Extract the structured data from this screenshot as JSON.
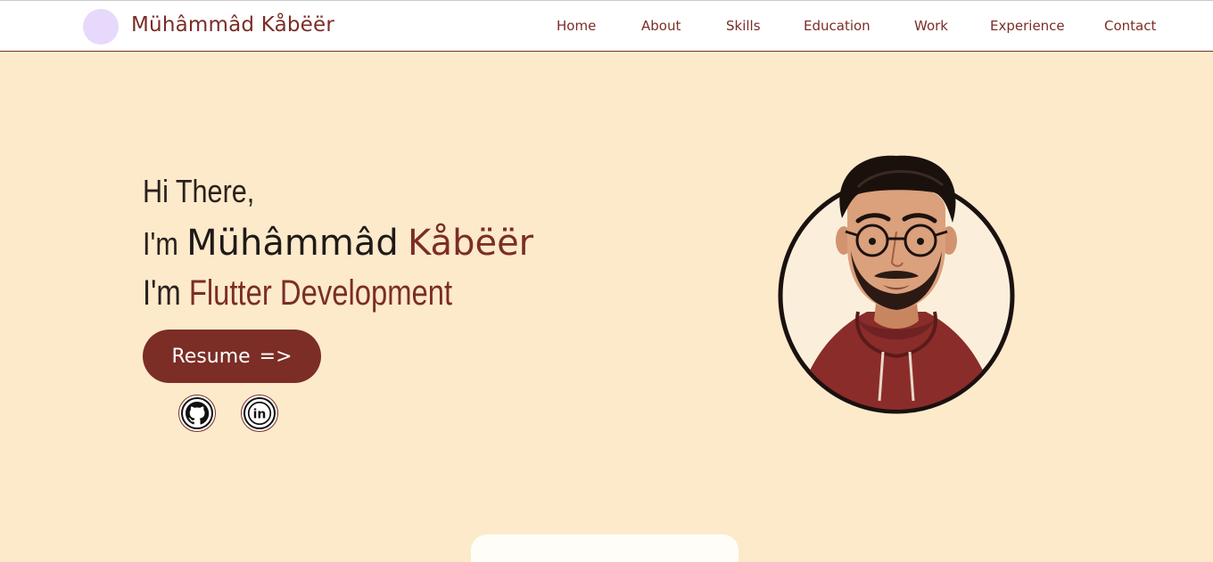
{
  "header": {
    "brand": "Mühâmmâd Kåbëër",
    "nav": [
      {
        "label": "Home"
      },
      {
        "label": "About"
      },
      {
        "label": "Skills"
      },
      {
        "label": "Education"
      },
      {
        "label": "Work"
      },
      {
        "label": "Experience"
      },
      {
        "label": "Contact"
      }
    ]
  },
  "hero": {
    "greeting": "Hi There,",
    "im": "I'm",
    "first_name": "Mühâmmâd",
    "last_name": "Kåbëër",
    "role_prefix": "I'm",
    "role": "Flutter Development",
    "resume_label": "Resume",
    "resume_arrow": "=>"
  },
  "icons": {
    "github": "github-icon",
    "linkedin": "linkedin-icon",
    "linkedin_text": "in"
  },
  "colors": {
    "background": "#fceacb",
    "accent": "#7b2d26",
    "text_dark": "#2a201c",
    "logo_circle": "#e6d9fb"
  }
}
